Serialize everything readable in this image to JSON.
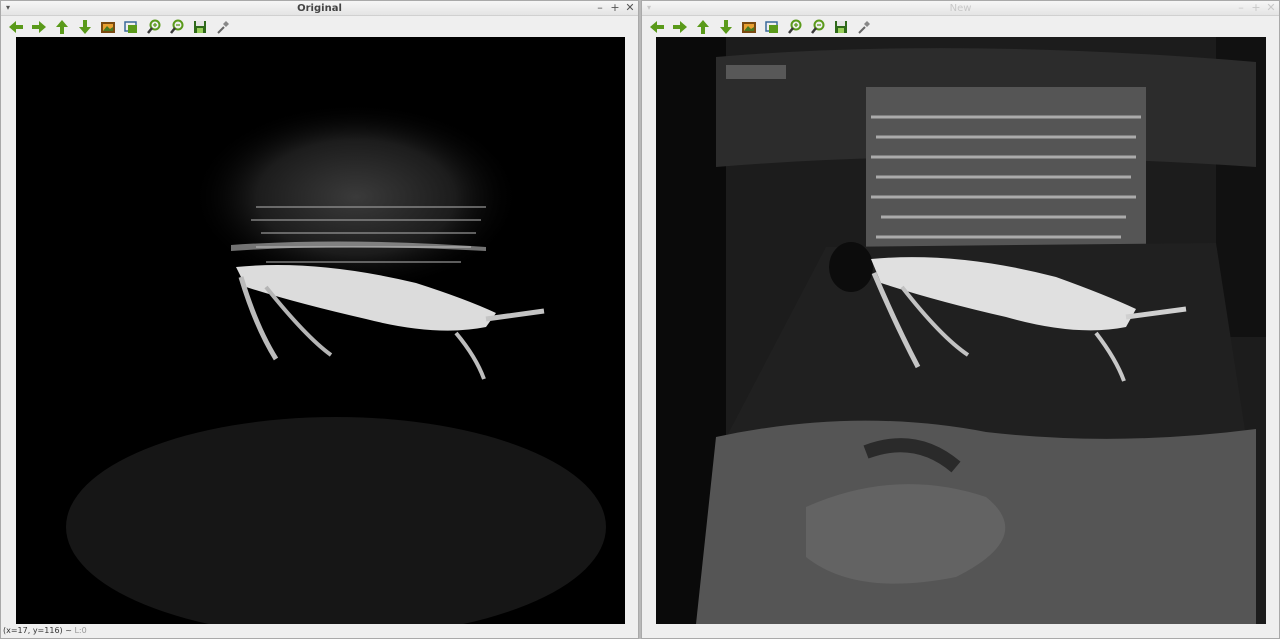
{
  "windows": {
    "original": {
      "title": "Original",
      "status": "(x=17, y=116) ~",
      "level": "L:0"
    },
    "processed": {
      "title": "New"
    }
  },
  "window_controls": {
    "menu": "▾",
    "minimize": "–",
    "maximize": "+",
    "close": "✕"
  },
  "toolbar": {
    "icons": [
      "arrow-left-icon",
      "arrow-right-icon",
      "arrow-up-icon",
      "arrow-down-icon",
      "save-image-icon",
      "save-screenshot-icon",
      "zoom-in-icon",
      "zoom-out-icon",
      "save-icon",
      "properties-icon"
    ]
  },
  "colors": {
    "accent_green": "#5a9a1a",
    "window_bg": "#efefef"
  }
}
